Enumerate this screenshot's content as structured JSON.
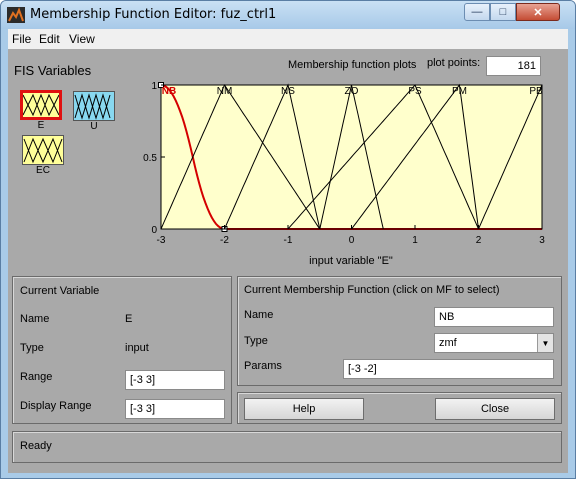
{
  "window": {
    "title": "Membership Function Editor: fuz_ctrl1"
  },
  "menu": {
    "file": "File",
    "edit": "Edit",
    "view": "View"
  },
  "fis_variables": {
    "label": "FIS Variables",
    "inputs": [
      {
        "name": "E",
        "selected": true
      },
      {
        "name": "EC",
        "selected": false
      }
    ],
    "outputs": [
      {
        "name": "U",
        "selected": false
      }
    ]
  },
  "plot": {
    "title": "Membership function plots",
    "plot_points_label": "plot points:",
    "plot_points_value": "181",
    "xlabel": "input variable \"E\"",
    "background": "#ffffcc",
    "selected_color": "#d40000",
    "line_color": "#000000",
    "xticks": [
      "-3",
      "-2",
      "-1",
      "0",
      "1",
      "2",
      "3"
    ],
    "yticks": [
      "0",
      "0.5",
      "1"
    ]
  },
  "chart_data": {
    "type": "line",
    "xlim": [
      -3,
      3
    ],
    "ylim": [
      0,
      1
    ],
    "xlabel": "input variable \"E\"",
    "series": [
      {
        "name": "NB",
        "mf": "zmf",
        "params": [
          -3,
          -2
        ],
        "selected": true
      },
      {
        "name": "NM",
        "mf": "trimf",
        "params": [
          -3,
          -2,
          -0.5
        ]
      },
      {
        "name": "NS",
        "mf": "trimf",
        "params": [
          -2,
          -1,
          -0.5
        ]
      },
      {
        "name": "ZO",
        "mf": "trimf",
        "params": [
          -0.5,
          0,
          0.5
        ]
      },
      {
        "name": "PS",
        "mf": "trimf",
        "params": [
          -1,
          1,
          2
        ]
      },
      {
        "name": "PM",
        "mf": "trimf",
        "params": [
          0,
          1.7,
          2
        ]
      },
      {
        "name": "PB",
        "mf": "trimf",
        "params": [
          2,
          3,
          4
        ]
      }
    ]
  },
  "current_variable": {
    "header": "Current Variable",
    "name_label": "Name",
    "name_value": "E",
    "type_label": "Type",
    "type_value": "input",
    "range_label": "Range",
    "range_value": "[-3 3]",
    "display_range_label": "Display Range",
    "display_range_value": "[-3 3]"
  },
  "current_mf": {
    "header": "Current Membership Function (click on MF to select)",
    "name_label": "Name",
    "name_value": "NB",
    "type_label": "Type",
    "type_value": "zmf",
    "params_label": "Params",
    "params_value": "[-3 -2]"
  },
  "buttons": {
    "help": "Help",
    "close": "Close"
  },
  "status": {
    "text": "Ready"
  }
}
